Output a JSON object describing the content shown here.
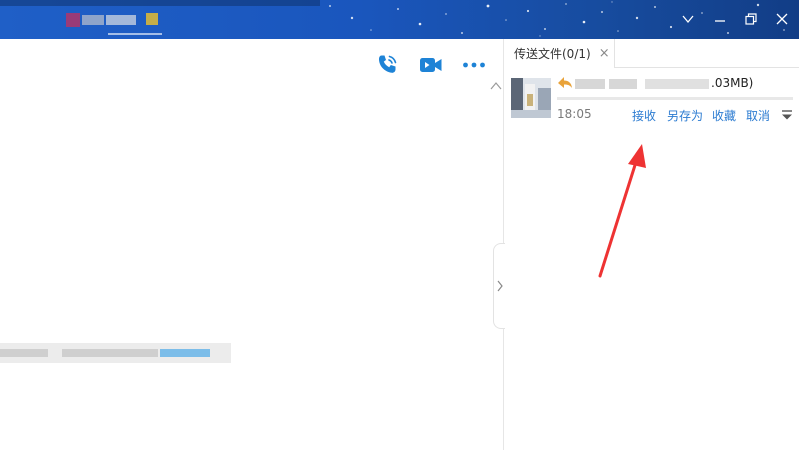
{
  "window": {
    "title_bar_color": "#1a56bd",
    "controls": [
      "chevron-down-icon",
      "minimize-icon",
      "restore-icon",
      "close-icon"
    ]
  },
  "chat": {
    "toolbar": [
      "phone-call-icon",
      "video-call-icon",
      "more-icon"
    ],
    "accent": "#1e83d6"
  },
  "transfer": {
    "tab_label": "传送文件(0/1)",
    "tab_close": "×",
    "file": {
      "name_visible_suffix": ".03MB)",
      "time": "18:05",
      "progress": 0,
      "actions": [
        "接收",
        "另存为",
        "收藏",
        "取消"
      ]
    },
    "link_color": "#2b7bd1"
  },
  "annotation": {
    "type": "arrow",
    "color": "#ee3333"
  }
}
